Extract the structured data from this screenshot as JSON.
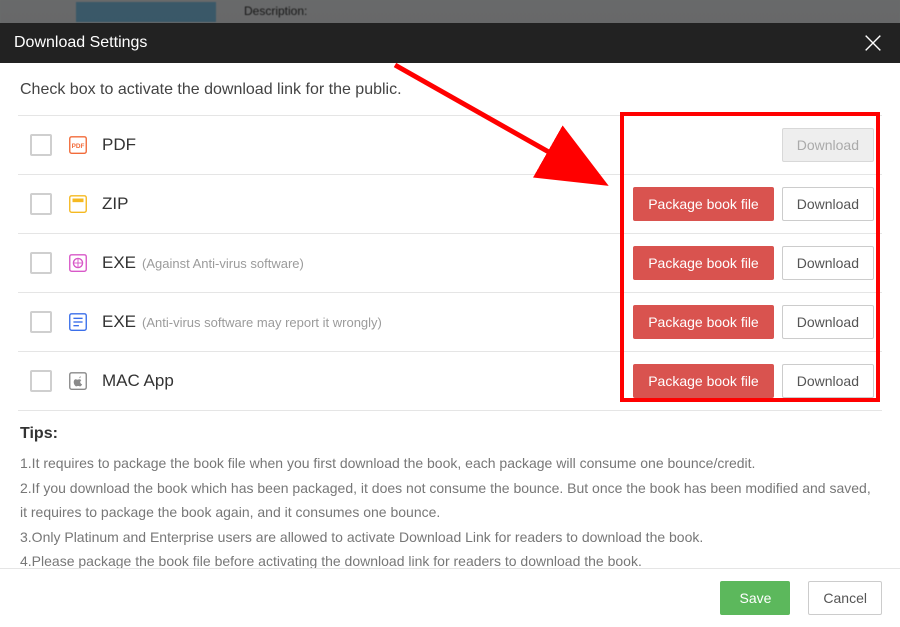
{
  "background": {
    "description_label": "Description:"
  },
  "dialog": {
    "title": "Download Settings",
    "instruction": "Check box to activate the download link for the public.",
    "tips_heading": "Tips:",
    "tips": [
      "1.It requires to package the book file when you first download the book, each package will consume one bounce/credit.",
      "2.If you download the book which has been packaged, it does not consume the bounce. But once the book has been modified and saved, it requires to package the book again, and it consumes one bounce.",
      "3.Only Platinum and Enterprise users are allowed to activate Download Link for readers to download the book.",
      "4.Please package the book file before activating the download link for readers to download the book."
    ],
    "options": {
      "pdf": {
        "label": "PDF",
        "sub": "",
        "package_label": "",
        "download_label": "Download"
      },
      "zip": {
        "label": "ZIP",
        "sub": "",
        "package_label": "Package book file",
        "download_label": "Download"
      },
      "exe1": {
        "label": "EXE",
        "sub": "(Against Anti-virus software)",
        "package_label": "Package book file",
        "download_label": "Download"
      },
      "exe2": {
        "label": "EXE",
        "sub": "(Anti-virus software may report it wrongly)",
        "package_label": "Package book file",
        "download_label": "Download"
      },
      "mac": {
        "label": "MAC App",
        "sub": "",
        "package_label": "Package book file",
        "download_label": "Download"
      }
    },
    "footer": {
      "save_label": "Save",
      "cancel_label": "Cancel"
    }
  },
  "colors": {
    "danger": "#d9534f",
    "success": "#5cb85c",
    "annot": "#ff0000"
  }
}
